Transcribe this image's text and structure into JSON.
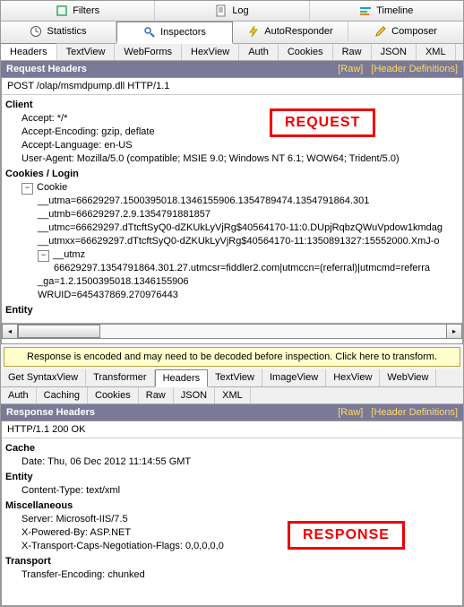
{
  "topTabs1": [
    {
      "id": "filters",
      "label": "Filters"
    },
    {
      "id": "log",
      "label": "Log"
    },
    {
      "id": "timeline",
      "label": "Timeline"
    }
  ],
  "topTabs2": [
    {
      "id": "statistics",
      "label": "Statistics"
    },
    {
      "id": "inspectors",
      "label": "Inspectors"
    },
    {
      "id": "autoresponder",
      "label": "AutoResponder"
    },
    {
      "id": "composer",
      "label": "Composer"
    }
  ],
  "reqSubTabs": [
    "Headers",
    "TextView",
    "WebForms",
    "HexView",
    "Auth",
    "Cookies",
    "Raw",
    "JSON",
    "XML"
  ],
  "reqHeader": {
    "title": "Request Headers",
    "rawLink": "[Raw]",
    "defLink": "[Header Definitions]"
  },
  "reqLine": "POST /olap/msmdpump.dll HTTP/1.1",
  "reqTree": {
    "client": {
      "label": "Client",
      "items": [
        "Accept: */*",
        "Accept-Encoding: gzip, deflate",
        "Accept-Language: en-US",
        "User-Agent: Mozilla/5.0 (compatible; MSIE 9.0; Windows NT 6.1; WOW64; Trident/5.0)"
      ]
    },
    "cookies": {
      "label": "Cookies / Login",
      "cookieLabel": "Cookie",
      "items": [
        "__utma=66629297.1500395018.1346155906.1354789474.1354791864.301",
        "__utmb=66629297.2.9.1354791881857",
        "__utmc=66629297.dTtcftSyQ0-dZKUkLyVjRg$40564170-11:0.DUpjRqbzQWuVpdow1kmdag",
        "__utmxx=66629297.dTtcftSyQ0-dZKUkLyVjRg$40564170-11:1350891327:15552000.XmJ-o"
      ],
      "utmz": {
        "label": "__utmz",
        "value": "66629297.1354791864.301.27.utmcsr=fiddler2.com|utmccn=(referral)|utmcmd=referra"
      },
      "tail": [
        "_ga=1.2.1500395018.1346155906",
        "WRUID=645437869.270976443"
      ]
    },
    "entity": {
      "label": "Entity"
    }
  },
  "decodeBar": "Response is encoded and may need to be decoded before inspection. Click here to transform.",
  "respSubTabs1": [
    "Get SyntaxView",
    "Transformer",
    "Headers",
    "TextView",
    "ImageView",
    "HexView",
    "WebView"
  ],
  "respSubTabs2": [
    "Auth",
    "Caching",
    "Cookies",
    "Raw",
    "JSON",
    "XML"
  ],
  "respHeader": {
    "title": "Response Headers",
    "rawLink": "[Raw]",
    "defLink": "[Header Definitions]"
  },
  "respLine": "HTTP/1.1 200 OK",
  "respTree": {
    "cache": {
      "label": "Cache",
      "items": [
        "Date: Thu, 06 Dec 2012 11:14:55 GMT"
      ]
    },
    "entity": {
      "label": "Entity",
      "items": [
        "Content-Type: text/xml"
      ]
    },
    "misc": {
      "label": "Miscellaneous",
      "items": [
        "Server: Microsoft-IIS/7.5",
        "X-Powered-By: ASP.NET",
        "X-Transport-Caps-Negotiation-Flags: 0,0,0,0,0"
      ]
    },
    "transport": {
      "label": "Transport",
      "items": [
        "Transfer-Encoding: chunked"
      ]
    }
  },
  "ann": {
    "req": "REQUEST",
    "resp": "RESPONSE"
  }
}
